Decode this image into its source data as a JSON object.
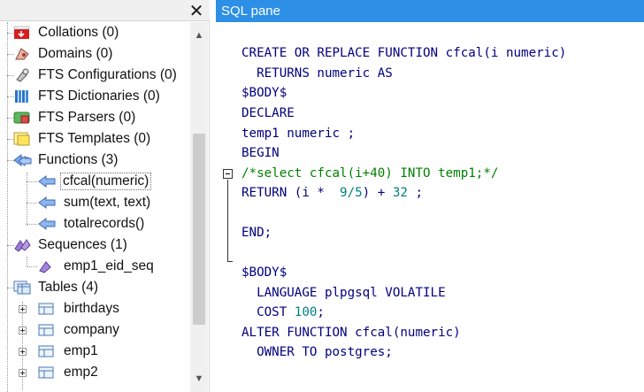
{
  "left_panel": {
    "close_label": "✕",
    "scroll_up": "▲",
    "scroll_down": "▼",
    "tree": [
      {
        "label": "Collations (0)",
        "icon": "collations-icon"
      },
      {
        "label": "Domains (0)",
        "icon": "domains-icon"
      },
      {
        "label": "FTS Configurations (0)",
        "icon": "fts-configurations-icon"
      },
      {
        "label": "FTS Dictionaries (0)",
        "icon": "fts-dictionaries-icon"
      },
      {
        "label": "FTS Parsers (0)",
        "icon": "fts-parsers-icon"
      },
      {
        "label": "FTS Templates (0)",
        "icon": "fts-templates-icon"
      },
      {
        "label": "Functions (3)",
        "icon": "functions-icon"
      },
      {
        "label": "cfcal(numeric)",
        "icon": "function-icon",
        "selected": true
      },
      {
        "label": "sum(text, text)",
        "icon": "function-icon"
      },
      {
        "label": "totalrecords()",
        "icon": "function-icon"
      },
      {
        "label": "Sequences (1)",
        "icon": "sequences-icon"
      },
      {
        "label": "emp1_eid_seq",
        "icon": "sequence-icon"
      },
      {
        "label": "Tables (4)",
        "icon": "tables-icon"
      },
      {
        "label": "birthdays",
        "icon": "table-icon"
      },
      {
        "label": "company",
        "icon": "table-icon"
      },
      {
        "label": "emp1",
        "icon": "table-icon"
      },
      {
        "label": "emp2",
        "icon": "table-icon"
      }
    ]
  },
  "sql_pane": {
    "title": "SQL pane",
    "fold_marker": "−",
    "lines": [
      {
        "text": "CREATE OR REPLACE FUNCTION cfcal(i numeric)"
      },
      {
        "text": "  RETURNS numeric AS"
      },
      {
        "text": "$BODY$"
      },
      {
        "text": "DECLARE"
      },
      {
        "text": "temp1 numeric ;"
      },
      {
        "text": "BEGIN"
      },
      {
        "text": "/*select cfcal(i+40) INTO temp1;*/"
      },
      {
        "text_a": "RETURN (i *  ",
        "num1": "9/5",
        "text_b": ") + ",
        "num2": "32",
        "text_c": " ;"
      },
      {
        "text": ""
      },
      {
        "text": "END;"
      },
      {
        "text": ""
      },
      {
        "text": "$BODY$"
      },
      {
        "text": "  LANGUAGE plpgsql VOLATILE"
      },
      {
        "text_a": "  COST ",
        "num1": "100",
        "text_b": ";"
      },
      {
        "text": "ALTER FUNCTION cfcal(numeric)"
      },
      {
        "text": "  OWNER TO postgres;"
      }
    ]
  },
  "colors": {
    "title_bar": "#2d8fe6",
    "keyword": "#00007f",
    "comment": "#008000",
    "number": "#008080"
  }
}
